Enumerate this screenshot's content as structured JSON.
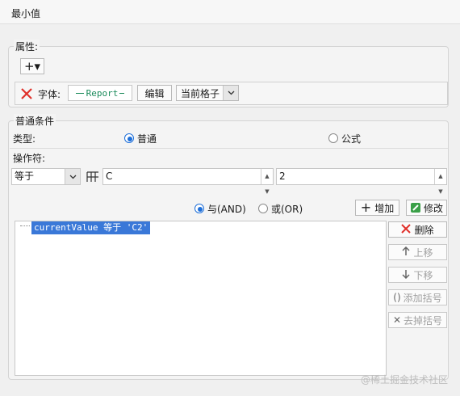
{
  "window": {
    "title": "最小值"
  },
  "attributes": {
    "section_title": "属性:",
    "add_button": "+▾",
    "font_label": "字体:",
    "font_preview": "Report",
    "edit_button": "编辑",
    "scope_select": "当前格子"
  },
  "conditions": {
    "section_title": "普通条件",
    "type_label": "类型:",
    "type_normal": "普通",
    "type_formula": "公式",
    "type_selected": "普通",
    "operator_label": "操作符:",
    "operator_value": "等于",
    "left_value": "C",
    "right_value": "2",
    "logic_and": "与(AND)",
    "logic_or": "或(OR)",
    "logic_selected": "与(AND)",
    "add_button": "增加",
    "modify_button": "修改",
    "list": [
      "currentValue 等于 'C2'"
    ],
    "delete_button": "删除",
    "up_button": "上移",
    "down_button": "下移",
    "add_paren_button": "添加括号",
    "remove_paren_button": "去掉括号"
  },
  "watermark": "@稀土掘金技术社区",
  "colors": {
    "accent": "#1e6fd9",
    "selection": "#3a78d8",
    "delete_red": "#e0302a",
    "font_preview": "#1a8a5a"
  }
}
